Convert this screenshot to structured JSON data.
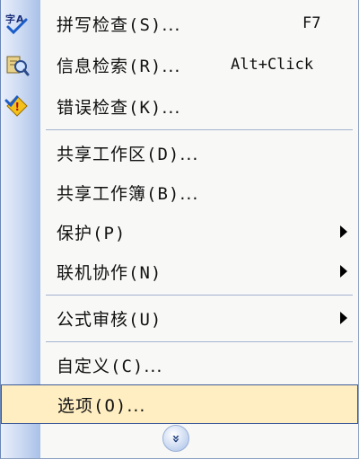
{
  "menu": {
    "items": [
      {
        "label": "拼写检查",
        "mnemonic": "(S)",
        "ellipsis": "...",
        "shortcut": "F7",
        "icon": "spellcheck-icon"
      },
      {
        "label": "信息检索",
        "mnemonic": "(R)",
        "ellipsis": "...",
        "shortcut": "Alt+Click",
        "icon": "research-icon"
      },
      {
        "label": "错误检查",
        "mnemonic": "(K)",
        "ellipsis": "...",
        "icon": "error-check-icon"
      },
      {
        "label": "共享工作区",
        "mnemonic": "(D)",
        "ellipsis": "..."
      },
      {
        "label": "共享工作簿",
        "mnemonic": "(B)",
        "ellipsis": "..."
      },
      {
        "label": "保护",
        "mnemonic": "(P)",
        "submenu": true
      },
      {
        "label": "联机协作",
        "mnemonic": "(N)",
        "submenu": true
      },
      {
        "label": "公式审核",
        "mnemonic": "(U)",
        "submenu": true
      },
      {
        "label": "自定义",
        "mnemonic": "(C)",
        "ellipsis": "..."
      },
      {
        "label": "选项",
        "mnemonic": "(O)",
        "ellipsis": "...",
        "highlighted": true
      }
    ],
    "expand_icon": "double-chevron-down-icon",
    "expand_glyph": "»"
  },
  "colors": {
    "gutter": "#c9d8f1",
    "highlight_bg": "#ffeec2",
    "highlight_border": "#3c5a98",
    "separator": "#a4b4d3"
  }
}
